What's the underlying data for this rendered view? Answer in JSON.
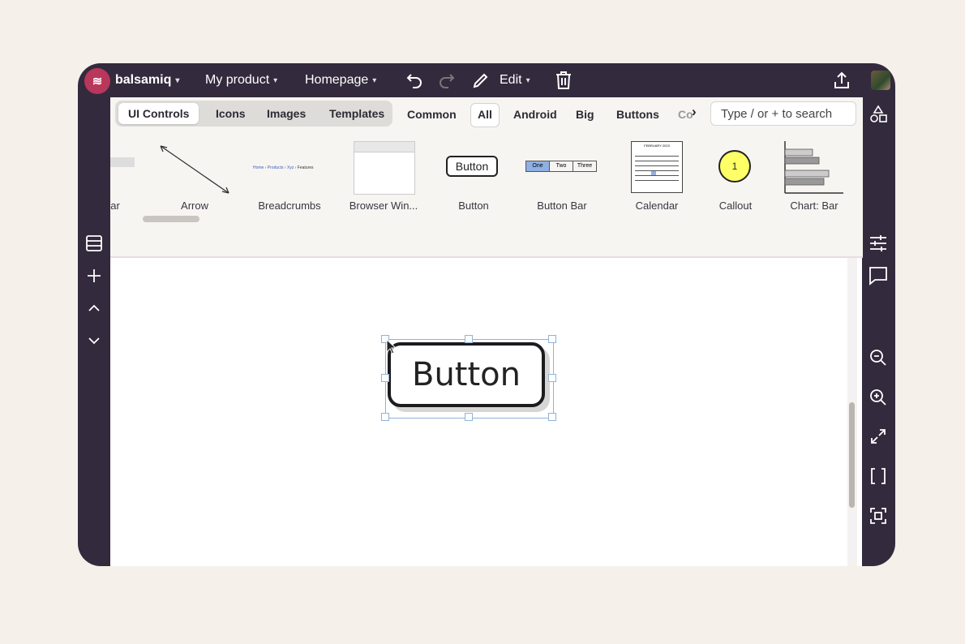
{
  "topbar": {
    "brand": "balsamiq",
    "project": "My product",
    "page": "Homepage",
    "edit": "Edit"
  },
  "filters": {
    "segments": [
      "UI Controls",
      "Icons",
      "Images",
      "Templates"
    ],
    "active_segment": "UI Controls",
    "chips": [
      "Common",
      "All",
      "Android",
      "Big",
      "Buttons",
      "Co"
    ],
    "active_chip": "All",
    "search_placeholder": "Type / or + to search"
  },
  "components": [
    {
      "label": "ar"
    },
    {
      "label": "Arrow"
    },
    {
      "label": "Breadcrumbs"
    },
    {
      "label": "Browser Win..."
    },
    {
      "label": "Button",
      "preview_text": "Button"
    },
    {
      "label": "Button Bar",
      "preview_tabs": [
        "One",
        "Two",
        "Three"
      ]
    },
    {
      "label": "Calendar",
      "preview_title": "FEBRUARY 2023"
    },
    {
      "label": "Callout",
      "preview_text": "1"
    },
    {
      "label": "Chart: Bar"
    }
  ],
  "breadcrumb_preview": [
    "Home",
    "Products",
    "Xyz",
    "Features"
  ],
  "canvas": {
    "selected_element_text": "Button"
  },
  "colors": {
    "frame": "#332a3d",
    "brand": "#b8375a",
    "selection": "#8fb3d8",
    "callout": "#ffff66",
    "button_bar_active": "#8fb0e3"
  }
}
